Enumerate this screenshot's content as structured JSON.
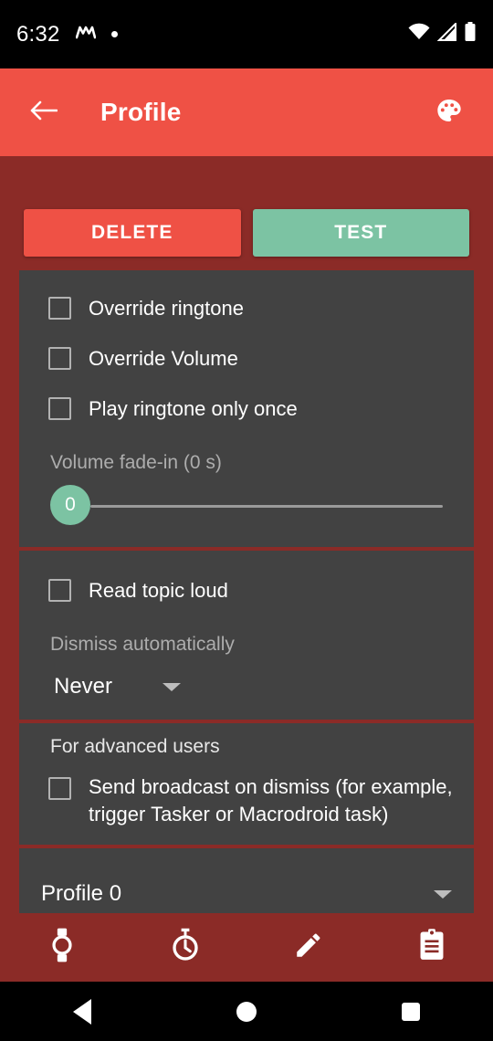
{
  "status_bar": {
    "time": "6:32",
    "left_icons": [
      "monzo-m-icon",
      "notification-dot-icon"
    ],
    "right_icons": [
      "wifi-icon",
      "cellular-signal-icon",
      "battery-icon"
    ]
  },
  "app_bar": {
    "back_icon": "arrow-back-icon",
    "title": "Profile",
    "action_icon": "color-palette-icon"
  },
  "actions": {
    "delete_label": "DELETE",
    "test_label": "TEST"
  },
  "sections": {
    "sound": {
      "checkboxes": [
        {
          "label": "Override ringtone",
          "checked": false
        },
        {
          "label": "Override Volume",
          "checked": false
        },
        {
          "label": "Play ringtone only once",
          "checked": false
        }
      ],
      "slider": {
        "label": "Volume fade-in (0 s)",
        "value": "0",
        "min": 0,
        "max": 100,
        "percent": 0
      }
    },
    "dismiss": {
      "checkbox": {
        "label": "Read topic loud",
        "checked": false
      },
      "dropdown_label": "Dismiss automatically",
      "dropdown_value": "Never"
    },
    "advanced": {
      "header": "For advanced users",
      "checkbox": {
        "label": "Send broadcast on dismiss (for example, trigger Tasker or Macrodroid task)",
        "checked": false
      }
    },
    "profile": {
      "value": "Profile 0"
    }
  },
  "bottom_nav": {
    "items": [
      {
        "name": "watch-icon"
      },
      {
        "name": "stopwatch-icon"
      },
      {
        "name": "pencil-icon"
      },
      {
        "name": "clipboard-icon"
      }
    ]
  },
  "system_nav": {
    "back": "back-triangle-icon",
    "home": "home-circle-icon",
    "recents": "recents-square-icon"
  },
  "colors": {
    "accent": "#EF5145",
    "background": "#8B2B27",
    "card": "#424242",
    "green": "#7CC3A3"
  }
}
